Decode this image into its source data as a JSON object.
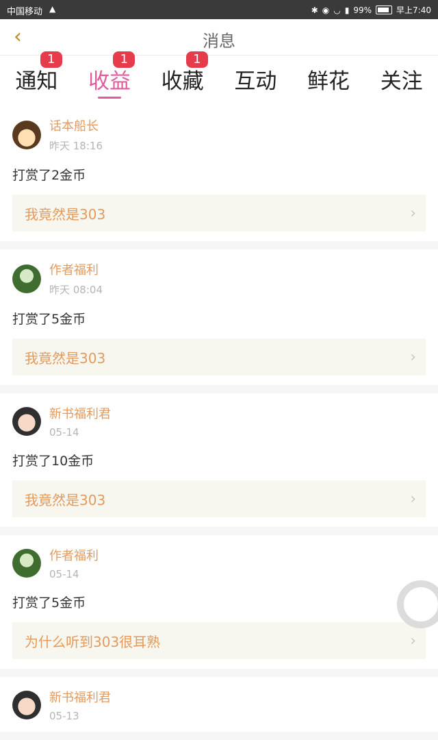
{
  "status_bar": {
    "carrier": "中国移动",
    "battery": "99%",
    "time": "早上7:40"
  },
  "header": {
    "title": "消息"
  },
  "tabs": [
    {
      "label": "通知",
      "badge": "1"
    },
    {
      "label": "收益",
      "badge": "1",
      "active": true
    },
    {
      "label": "收藏",
      "badge": "1"
    },
    {
      "label": "互动"
    },
    {
      "label": "鲜花"
    },
    {
      "label": "关注"
    }
  ],
  "items": [
    {
      "name": "话本船长",
      "time": "昨天 18:16",
      "message": "打赏了2金币",
      "link": "我竟然是303"
    },
    {
      "name": "作者福利",
      "time": "昨天 08:04",
      "message": "打赏了5金币",
      "link": "我竟然是303"
    },
    {
      "name": "新书福利君",
      "time": "05-14",
      "message": "打赏了10金币",
      "link": "我竟然是303"
    },
    {
      "name": "作者福利",
      "time": "05-14",
      "message": "打赏了5金币",
      "link": "为什么听到303很耳熟"
    },
    {
      "name": "新书福利君",
      "time": "05-13"
    }
  ],
  "colors": {
    "accent": "#e25a9c",
    "name": "#e39a5c",
    "badge": "#e63b4a"
  }
}
